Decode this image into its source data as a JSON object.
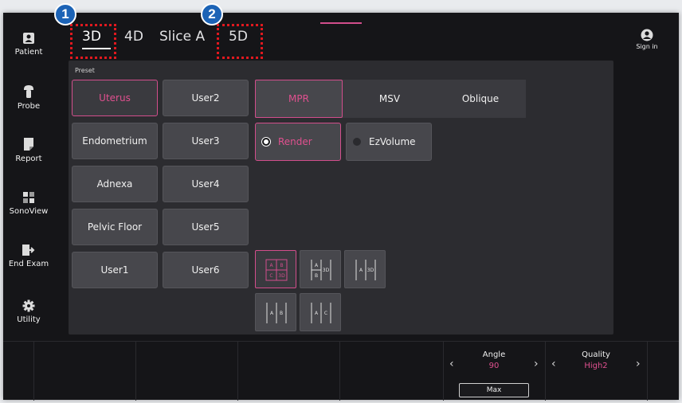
{
  "sidebar": {
    "items": [
      {
        "label": "Patient",
        "icon": "patient-icon"
      },
      {
        "label": "Probe",
        "icon": "probe-icon"
      },
      {
        "label": "Report",
        "icon": "report-icon"
      },
      {
        "label": "SonoView",
        "icon": "sonoview-icon"
      },
      {
        "label": "End Exam",
        "icon": "end-exam-icon"
      },
      {
        "label": "Utility",
        "icon": "gear-icon"
      }
    ]
  },
  "tabs": [
    {
      "label": "3D",
      "active": true
    },
    {
      "label": "4D"
    },
    {
      "label": "Slice A"
    },
    {
      "label": "5D"
    }
  ],
  "callouts": [
    "1",
    "2"
  ],
  "signin": {
    "label": "Sign in",
    "icon": "user-icon"
  },
  "preset": {
    "title": "Preset",
    "column1": [
      "Uterus",
      "Endometrium",
      "Adnexa",
      "Pelvic Floor",
      "User1"
    ],
    "column2": [
      "User2",
      "User3",
      "User4",
      "User5",
      "User6"
    ],
    "selected": "Uterus"
  },
  "view_modes": {
    "items": [
      "MPR",
      "MSV",
      "Oblique"
    ],
    "selected": "MPR"
  },
  "render_modes": {
    "items": [
      "Render",
      "EzVolume"
    ],
    "selected": "Render"
  },
  "layouts": {
    "row1": [
      {
        "name": "layout-quad",
        "labels": [
          "A",
          "B",
          "C",
          "3D"
        ]
      },
      {
        "name": "layout-ab-3d",
        "labels": [
          "A",
          "B",
          "3D"
        ]
      },
      {
        "name": "layout-a-3d",
        "labels": [
          "A",
          "3D"
        ]
      }
    ],
    "row2": [
      {
        "name": "layout-a-b",
        "labels": [
          "A",
          "B"
        ]
      },
      {
        "name": "layout-a-c",
        "labels": [
          "A",
          "C"
        ]
      }
    ],
    "selected": "layout-quad"
  },
  "bottom": {
    "angle": {
      "label": "Angle",
      "value": "90"
    },
    "quality": {
      "label": "Quality",
      "value": "High2"
    },
    "max_label": "Max"
  },
  "colors": {
    "accent": "#d24e8c",
    "panel": "#2c2c30",
    "button": "#47474c",
    "badge": "#1c63b6",
    "callout_border": "#e0191f"
  }
}
